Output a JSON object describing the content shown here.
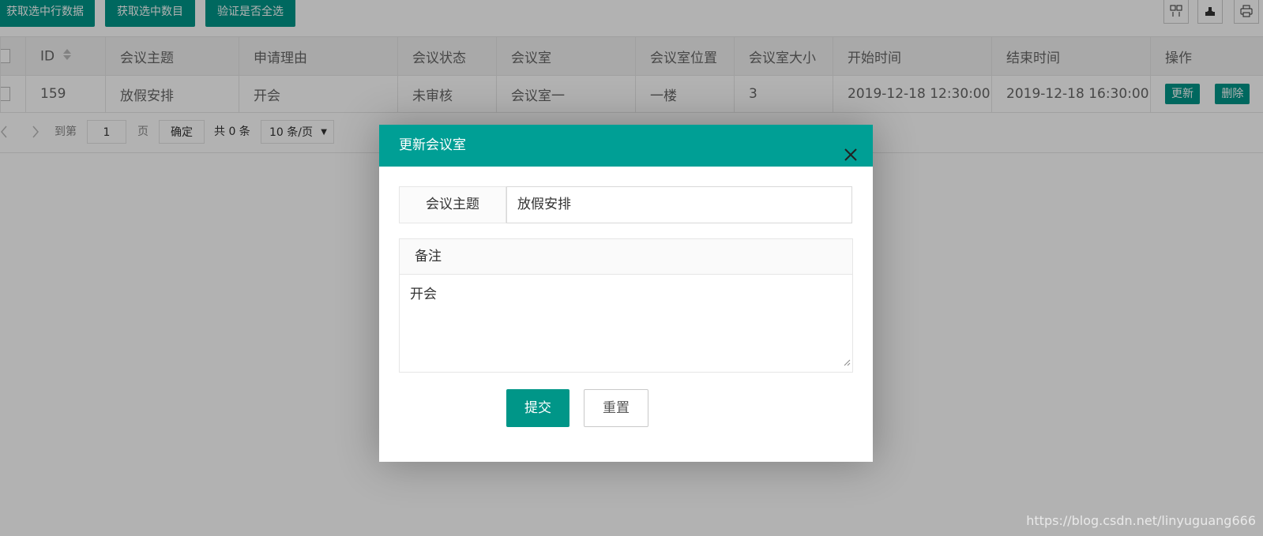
{
  "toolbar": {
    "buttons": [
      "获取选中行数据",
      "获取选中数目",
      "验证是否全选"
    ],
    "icons": [
      "columns-icon",
      "export-icon",
      "print-icon"
    ]
  },
  "table": {
    "columns": [
      "",
      "ID",
      "会议主题",
      "申请理由",
      "会议状态",
      "会议室",
      "会议室位置",
      "会议室大小",
      "开始时间",
      "结束时间",
      "操作"
    ],
    "rows": [
      {
        "id": "159",
        "topic": "放假安排",
        "reason": "开会",
        "status": "未审核",
        "room": "会议室一",
        "location": "一楼",
        "size": "3",
        "start": "2019-12-18 12:30:00",
        "end": "2019-12-18 16:30:00",
        "actions": [
          "更新",
          "删除"
        ]
      }
    ]
  },
  "pager": {
    "goto_label": "到第",
    "page_value": "1",
    "page_unit": "页",
    "confirm": "确定",
    "total": "共 0 条",
    "per_page": "10 条/页"
  },
  "modal": {
    "title": "更新会议室",
    "topic_label": "会议主题",
    "topic_value": "放假安排",
    "remark_label": "备注",
    "remark_value": "开会",
    "submit": "提交",
    "reset": "重置"
  },
  "watermark": "https://blog.csdn.net/linyuguang666",
  "colors": {
    "accent": "#009688",
    "modal_header": "#009f95"
  }
}
